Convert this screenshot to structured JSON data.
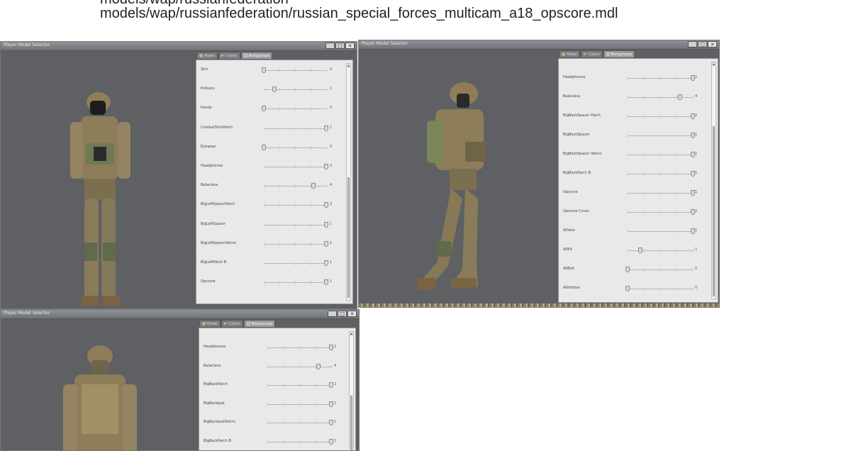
{
  "header": {
    "line_above": "models/wap/russianfederation",
    "model_path": "models/wap/russianfederation/russian_special_forces_multicam_a18_opscore.mdl"
  },
  "colors": {
    "viewport_bg": "#5e6063",
    "panel_bg": "#e9e9e9",
    "camo_tan": "#a99472",
    "camo_green": "#6f7a55"
  },
  "windows": [
    {
      "title": "Player Model Selector",
      "buttons": {
        "minimize": "_",
        "maximize": "□",
        "close": "✕"
      },
      "tabs": [
        {
          "label": "Model",
          "icon": "person-icon"
        },
        {
          "label": "Colors",
          "icon": "palette-icon"
        },
        {
          "label": "Bodygroups",
          "icon": "gear-icon",
          "active": true
        }
      ],
      "bodygroups": [
        {
          "label": "Skin",
          "value": "0",
          "level": 0.0
        },
        {
          "label": "Pullouts",
          "value": "1",
          "level": 0.17
        },
        {
          "label": "Hands",
          "value": "0",
          "level": 0.0
        },
        {
          "label": "CombatShirtPatch",
          "value": "1",
          "level": 1.0
        },
        {
          "label": "Eyewear",
          "value": "0",
          "level": 0.0
        },
        {
          "label": "Headphones",
          "value": "2",
          "level": 1.0
        },
        {
          "label": "Balaclava",
          "value": "4",
          "level": 0.8
        },
        {
          "label": "BigLeftSpacerPatch",
          "value": "2",
          "level": 1.0
        },
        {
          "label": "BigLeftSpacer",
          "value": "1",
          "level": 1.0
        },
        {
          "label": "BigLeftSpacerVelcro",
          "value": "1",
          "level": 1.0
        },
        {
          "label": "BigLeftPatch B",
          "value": "1",
          "level": 1.0
        },
        {
          "label": "Opscore",
          "value": "1",
          "level": 1.0
        }
      ]
    },
    {
      "title": "Player Model Selector",
      "buttons": {
        "minimize": "_",
        "maximize": "□",
        "close": "✕"
      },
      "tabs": [
        {
          "label": "Model",
          "icon": "person-icon"
        },
        {
          "label": "Colors",
          "icon": "palette-icon"
        },
        {
          "label": "Bodygroups",
          "icon": "gear-icon",
          "active": true
        }
      ],
      "bodygroups": [
        {
          "label": "Headphones",
          "value": "2",
          "level": 1.0
        },
        {
          "label": "Balaclava",
          "value": "4",
          "level": 0.8
        },
        {
          "label": "BigBackSpacer Patch",
          "value": "2",
          "level": 1.0
        },
        {
          "label": "BigBackSpacer",
          "value": "1",
          "level": 1.0
        },
        {
          "label": "BigBackSpacer Velcro",
          "value": "1",
          "level": 1.0
        },
        {
          "label": "BigBackPatch B",
          "value": "1",
          "level": 1.0
        },
        {
          "label": "Opscore",
          "value": "1",
          "level": 1.0
        },
        {
          "label": "Opscore Cover",
          "value": "2",
          "level": 1.0
        },
        {
          "label": "AllVest",
          "value": "1",
          "level": 1.0
        },
        {
          "label": "AllKit",
          "value": "1",
          "level": 0.2
        },
        {
          "label": "AllBelt",
          "value": "0",
          "level": 0.0
        },
        {
          "label": "AllHolster",
          "value": "0",
          "level": 0.0
        }
      ]
    },
    {
      "title": "Player Model Selector",
      "buttons": {
        "minimize": "_",
        "maximize": "□",
        "close": "✕"
      },
      "tabs": [
        {
          "label": "Model",
          "icon": "person-icon"
        },
        {
          "label": "Colors",
          "icon": "palette-icon"
        },
        {
          "label": "Bodygroups",
          "icon": "gear-icon",
          "active": true
        }
      ],
      "bodygroups": [
        {
          "label": "Headphones",
          "value": "2",
          "level": 1.0
        },
        {
          "label": "Balaclava",
          "value": "4",
          "level": 0.8
        },
        {
          "label": "BigBackPatch",
          "value": "2",
          "level": 1.0
        },
        {
          "label": "BigBackpad",
          "value": "1",
          "level": 1.0
        },
        {
          "label": "BigBackpadVelcro",
          "value": "1",
          "level": 1.0
        },
        {
          "label": "BigBackPatch B",
          "value": "1",
          "level": 1.0
        }
      ]
    }
  ]
}
